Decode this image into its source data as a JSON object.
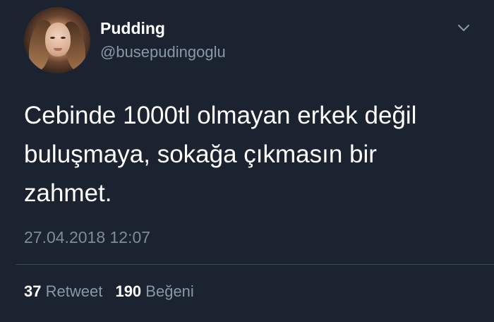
{
  "tweet": {
    "display_name": "Pudding",
    "handle": "@busepudingoglu",
    "text": "Cebinde 1000tl olmayan erkek değil buluşmaya, sokağa çıkmasın bir zahmet.",
    "timestamp": "27.04.2018 12:07",
    "avatar_icon": "profile-photo",
    "menu_icon": "chevron-down-icon"
  },
  "stats": {
    "retweet_count": "37",
    "retweet_label": "Retweet",
    "like_count": "190",
    "like_label": "Beğeni"
  },
  "colors": {
    "background": "#1b2230",
    "primary_text": "#ffffff",
    "secondary_text": "#8899a6",
    "divider": "#38444d"
  }
}
